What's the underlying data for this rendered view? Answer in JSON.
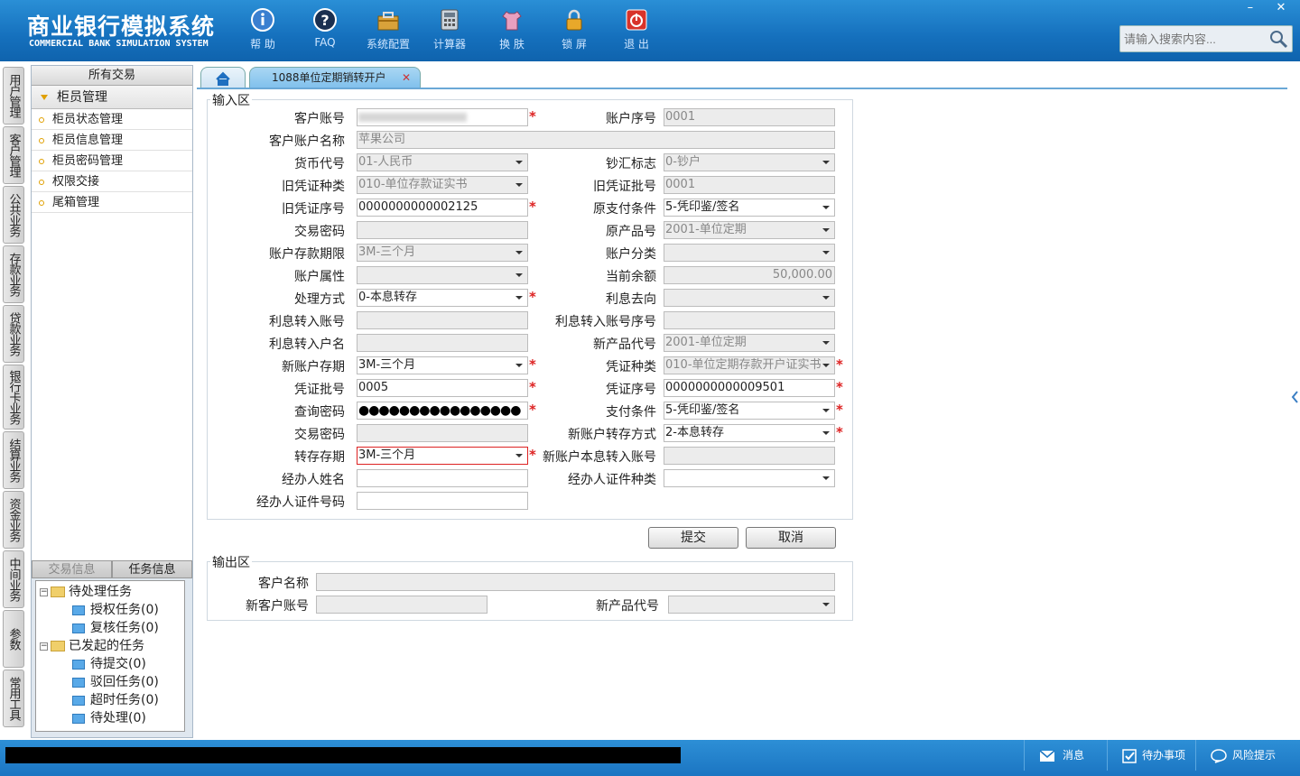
{
  "app": {
    "title": "商业银行模拟系统",
    "subtitle": "COMMERCIAL BANK SIMULATION SYSTEM"
  },
  "toolbar": [
    {
      "label": "帮 助",
      "icon": "info-icon"
    },
    {
      "label": "FAQ",
      "icon": "question-icon"
    },
    {
      "label": "系统配置",
      "icon": "toolbox-icon"
    },
    {
      "label": "计算器",
      "icon": "calculator-icon"
    },
    {
      "label": "换 肤",
      "icon": "shirt-icon"
    },
    {
      "label": "锁 屏",
      "icon": "lock-icon"
    },
    {
      "label": "退 出",
      "icon": "power-icon"
    }
  ],
  "window": {
    "minimize": "–",
    "close": "✕"
  },
  "search": {
    "placeholder": "请输入搜索内容..."
  },
  "vtabs": [
    "用户管理",
    "客户管理",
    "公共业务",
    "存款业务",
    "贷款业务",
    "银行卡业务",
    "结算业务",
    "资金业务",
    "中间业务",
    "参数",
    "常用工具"
  ],
  "left_panel": {
    "header": "所有交易",
    "group": "柜员管理",
    "items": [
      "柜员状态管理",
      "柜员信息管理",
      "柜员密码管理",
      "权限交接",
      "尾箱管理"
    ]
  },
  "info_tabs": {
    "tab1": "交易信息",
    "tab2": "任务信息"
  },
  "tree": {
    "pending": {
      "label": "待处理任务",
      "children": [
        "授权任务(0)",
        "复核任务(0)"
      ]
    },
    "initiated": {
      "label": "已发起的任务",
      "children": [
        "待提交(0)",
        "驳回任务(0)",
        "超时任务(0)",
        "待处理(0)"
      ]
    }
  },
  "tabs": {
    "active": "1088单位定期销转开户",
    "close": "✕"
  },
  "input_area": {
    "legend": "输入区",
    "fields": {
      "cust_account": {
        "label": "客户账号",
        "value": ""
      },
      "acct_seq": {
        "label": "账户序号",
        "value": "0001"
      },
      "cust_name": {
        "label": "客户账户名称",
        "value": "苹果公司"
      },
      "currency": {
        "label": "货币代号",
        "value": "01-人民币"
      },
      "cash_flag": {
        "label": "钞汇标志",
        "value": "0-钞户"
      },
      "old_voucher_type": {
        "label": "旧凭证种类",
        "value": "010-单位存款证实书"
      },
      "old_voucher_batch": {
        "label": "旧凭证批号",
        "value": "0001"
      },
      "old_voucher_seq": {
        "label": "旧凭证序号",
        "value": "0000000000002125"
      },
      "orig_pay_cond": {
        "label": "原支付条件",
        "value": "5-凭印鉴/签名"
      },
      "trade_pwd1": {
        "label": "交易密码",
        "value": ""
      },
      "orig_product": {
        "label": "原产品号",
        "value": "2001-单位定期"
      },
      "term": {
        "label": "账户存款期限",
        "value": "3M-三个月"
      },
      "acct_class": {
        "label": "账户分类",
        "value": ""
      },
      "acct_attr": {
        "label": "账户属性",
        "value": ""
      },
      "balance": {
        "label": "当前余额",
        "value": "50,000.00"
      },
      "process_mode": {
        "label": "处理方式",
        "value": "0-本息转存"
      },
      "interest_dest": {
        "label": "利息去向",
        "value": ""
      },
      "int_acct": {
        "label": "利息转入账号",
        "value": ""
      },
      "int_acct_seq": {
        "label": "利息转入账号序号",
        "value": ""
      },
      "int_acct_name": {
        "label": "利息转入户名",
        "value": ""
      },
      "new_product": {
        "label": "新产品代号",
        "value": "2001-单位定期"
      },
      "new_term": {
        "label": "新账户存期",
        "value": "3M-三个月"
      },
      "voucher_type": {
        "label": "凭证种类",
        "value": "010-单位定期存款开户证实书"
      },
      "voucher_batch": {
        "label": "凭证批号",
        "value": "0005"
      },
      "voucher_seq": {
        "label": "凭证序号",
        "value": "0000000000009501"
      },
      "query_pwd": {
        "label": "查询密码",
        "value": "●●●●●●●●●●●●●●●●"
      },
      "pay_cond": {
        "label": "支付条件",
        "value": "5-凭印鉴/签名"
      },
      "trade_pwd2": {
        "label": "交易密码",
        "value": ""
      },
      "transfer_mode": {
        "label": "新账户转存方式",
        "value": "2-本息转存"
      },
      "transfer_term": {
        "label": "转存存期",
        "value": "3M-三个月"
      },
      "new_int_acct": {
        "label": "新账户本息转入账号",
        "value": ""
      },
      "agent_name": {
        "label": "经办人姓名",
        "value": ""
      },
      "agent_id_type": {
        "label": "经办人证件种类",
        "value": ""
      },
      "agent_id_no": {
        "label": "经办人证件号码",
        "value": ""
      }
    },
    "submit": "提交",
    "cancel": "取消"
  },
  "output_area": {
    "legend": "输出区",
    "cust_name": {
      "label": "客户名称",
      "value": ""
    },
    "new_acct": {
      "label": "新客户账号",
      "value": ""
    },
    "new_product": {
      "label": "新产品代号",
      "value": ""
    }
  },
  "statusbar": {
    "messages": "消息",
    "todo": "待办事项",
    "risk": "风险提示"
  },
  "colors": {
    "header": "#1570bd",
    "required": "#d22222",
    "statusbar": "#1b75c2"
  }
}
